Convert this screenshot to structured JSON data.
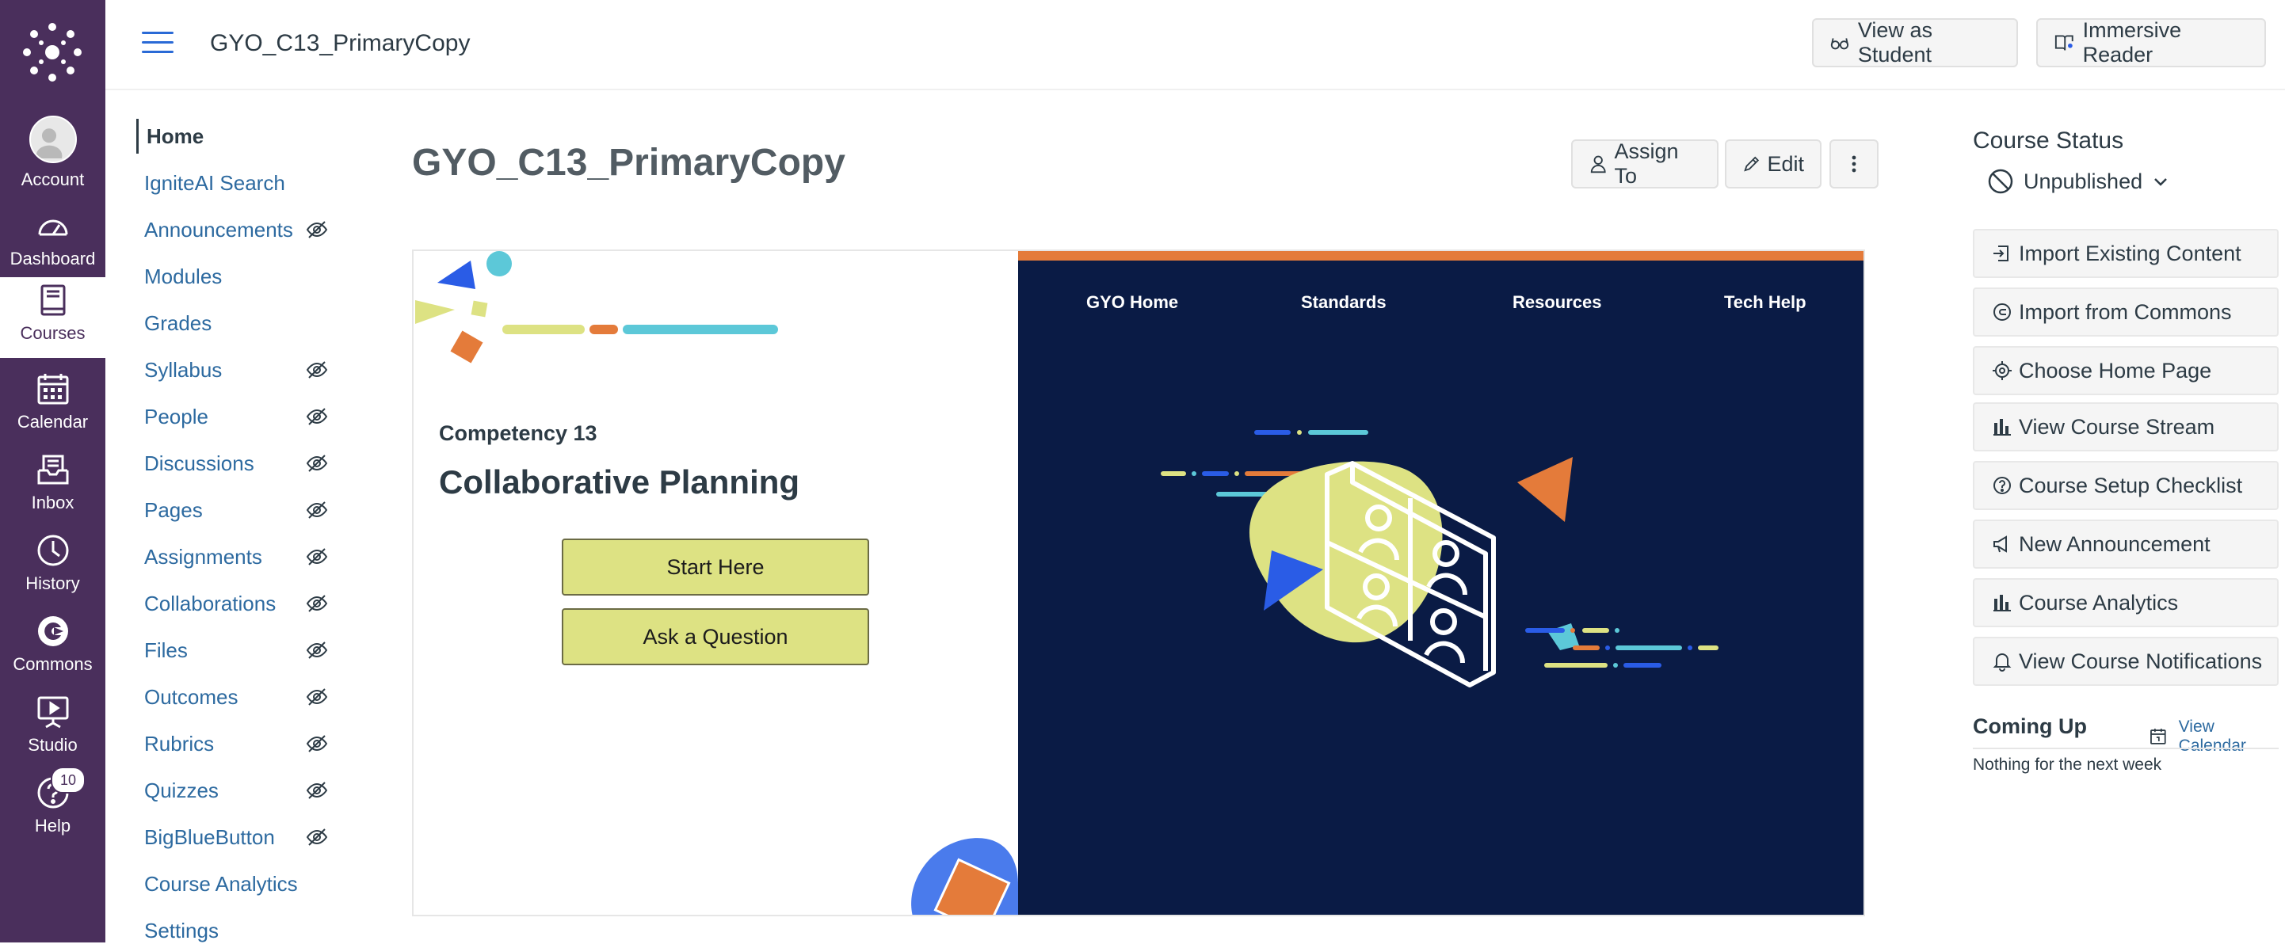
{
  "colors": {
    "global_nav_bg": "#4a2f5c",
    "link": "#2d6aa0",
    "banner_dark": "#0a1b45",
    "banner_orange": "#e47b3a",
    "banner_yellow": "#dde283",
    "banner_blue": "#2a5ce6",
    "banner_cyan": "#5cc8d8"
  },
  "global_nav": {
    "items": [
      {
        "label": "Account",
        "icon": "avatar-icon"
      },
      {
        "label": "Dashboard",
        "icon": "speedometer-icon"
      },
      {
        "label": "Courses",
        "icon": "book-icon",
        "active": true
      },
      {
        "label": "Calendar",
        "icon": "calendar-icon"
      },
      {
        "label": "Inbox",
        "icon": "inbox-icon"
      },
      {
        "label": "History",
        "icon": "clock-icon"
      },
      {
        "label": "Commons",
        "icon": "commons-icon"
      },
      {
        "label": "Studio",
        "icon": "studio-icon"
      },
      {
        "label": "Help",
        "icon": "help-icon",
        "badge": "10"
      }
    ]
  },
  "header": {
    "course_title": "GYO_C13_PrimaryCopy",
    "view_as_student": "View as Student",
    "immersive_reader": "Immersive Reader"
  },
  "course_nav": {
    "items": [
      {
        "label": "Home",
        "active": true,
        "hidden": false
      },
      {
        "label": "IgniteAI Search",
        "hidden": false
      },
      {
        "label": "Announcements",
        "hidden": true
      },
      {
        "label": "Modules",
        "hidden": false
      },
      {
        "label": "Grades",
        "hidden": false
      },
      {
        "label": "Syllabus",
        "hidden": true
      },
      {
        "label": "People",
        "hidden": true
      },
      {
        "label": "Discussions",
        "hidden": true
      },
      {
        "label": "Pages",
        "hidden": true
      },
      {
        "label": "Assignments",
        "hidden": true
      },
      {
        "label": "Collaborations",
        "hidden": true
      },
      {
        "label": "Files",
        "hidden": true
      },
      {
        "label": "Outcomes",
        "hidden": true
      },
      {
        "label": "Rubrics",
        "hidden": true
      },
      {
        "label": "Quizzes",
        "hidden": true
      },
      {
        "label": "BigBlueButton",
        "hidden": true
      },
      {
        "label": "Course Analytics",
        "hidden": false
      },
      {
        "label": "Settings",
        "hidden": false
      }
    ]
  },
  "main": {
    "page_title": "GYO_C13_PrimaryCopy",
    "assign_to": "Assign To",
    "edit": "Edit",
    "banner": {
      "competency": "Competency 13",
      "title": "Collaborative Planning",
      "start_here": "Start Here",
      "ask_question": "Ask a Question",
      "nav": [
        "GYO Home",
        "Standards",
        "Resources",
        "Tech Help"
      ]
    }
  },
  "sidebar": {
    "course_status": "Course Status",
    "unpublished": "Unpublished",
    "buttons": [
      {
        "label": "Import Existing Content",
        "icon": "import-icon"
      },
      {
        "label": "Import from Commons",
        "icon": "commons-icon"
      },
      {
        "label": "Choose Home Page",
        "icon": "target-icon"
      },
      {
        "label": "View Course Stream",
        "icon": "bar-chart-icon"
      },
      {
        "label": "Course Setup Checklist",
        "icon": "question-circle-icon"
      },
      {
        "label": "New Announcement",
        "icon": "megaphone-icon"
      },
      {
        "label": "Course Analytics",
        "icon": "bar-chart-icon"
      },
      {
        "label": "View Course Notifications",
        "icon": "bell-icon"
      }
    ],
    "coming_up": "Coming Up",
    "view_calendar": "View Calendar",
    "nothing": "Nothing for the next week"
  }
}
